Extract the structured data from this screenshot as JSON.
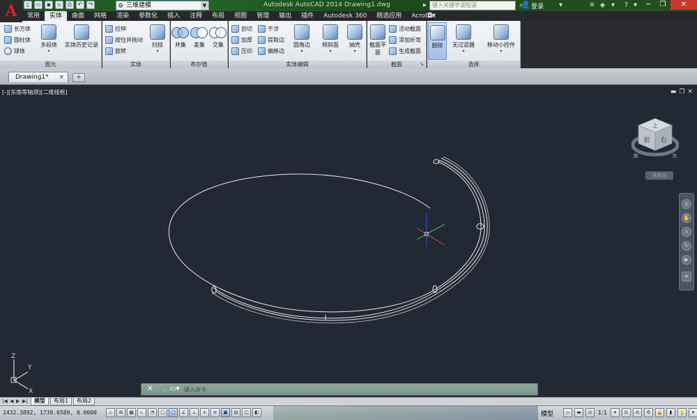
{
  "titlebar": {
    "workspace": "三维建模",
    "title": "Autodesk AutoCAD 2014    Drawing1.dwg",
    "search_placeholder": "键入关键字或短语",
    "login": "登录"
  },
  "ribbon_tabs": [
    "常用",
    "实体",
    "曲面",
    "网格",
    "渲染",
    "参数化",
    "插入",
    "注释",
    "布局",
    "视图",
    "管理",
    "输出",
    "插件",
    "Autodesk 360",
    "精选应用",
    "Acrobat"
  ],
  "active_tab": "实体",
  "panels": {
    "primitive": {
      "label": "图元",
      "box": "长方体",
      "cylinder": "圆柱体",
      "sphere": "球体",
      "polysolid": "多段体",
      "history": "实体历史记录"
    },
    "solid": {
      "label": "实体",
      "extrude": "拉伸",
      "presspull": "按住并拖动",
      "revolve": "旋转",
      "sweep": "扫掠"
    },
    "boolean": {
      "label": "布尔值",
      "union": "并集",
      "subtract": "差集",
      "intersect": "交集"
    },
    "solid_edit": {
      "label": "实体编辑",
      "slice": "剖切",
      "thicken": "加厚",
      "imprint": "压印",
      "interfere": "干涉",
      "extract_edges": "提取边",
      "offset_edges": "偏移边",
      "fillet_edge": "圆角边",
      "taper_faces": "倾斜面",
      "shell": "抽壳"
    },
    "section": {
      "label": "截面",
      "section_plane": "截面平面",
      "live_section": "活动截面",
      "add_jog": "添加折弯",
      "generate_section": "生成截面"
    },
    "selection": {
      "label": "选择",
      "delete": "删除",
      "no_filter": "无过滤器",
      "move_gizmo": "移动小控件"
    }
  },
  "document_tab": "Drawing1*",
  "viewport": {
    "label": "[-][东南等轴测][二维线框]",
    "viewcube_top": "上",
    "viewcube_front": "前",
    "viewcube_right": "右",
    "compass_s": "南",
    "compass_e": "东",
    "wcs_menu": "未命名"
  },
  "ucs": {
    "x": "X",
    "y": "Y",
    "z": "Z"
  },
  "command_line": {
    "prompt": "键入命令"
  },
  "layout_tabs": [
    "模型",
    "布局1",
    "布局2"
  ],
  "status": {
    "coordinates": "2432.3892, 1739.6589, 0.0000",
    "model": "模型",
    "scale": "1:1"
  },
  "colors": {
    "canvas_bg": "#222834",
    "ribbon_panel": "#e6eaef",
    "title_green": "#25672a",
    "active_tab": "#e9edf2"
  }
}
